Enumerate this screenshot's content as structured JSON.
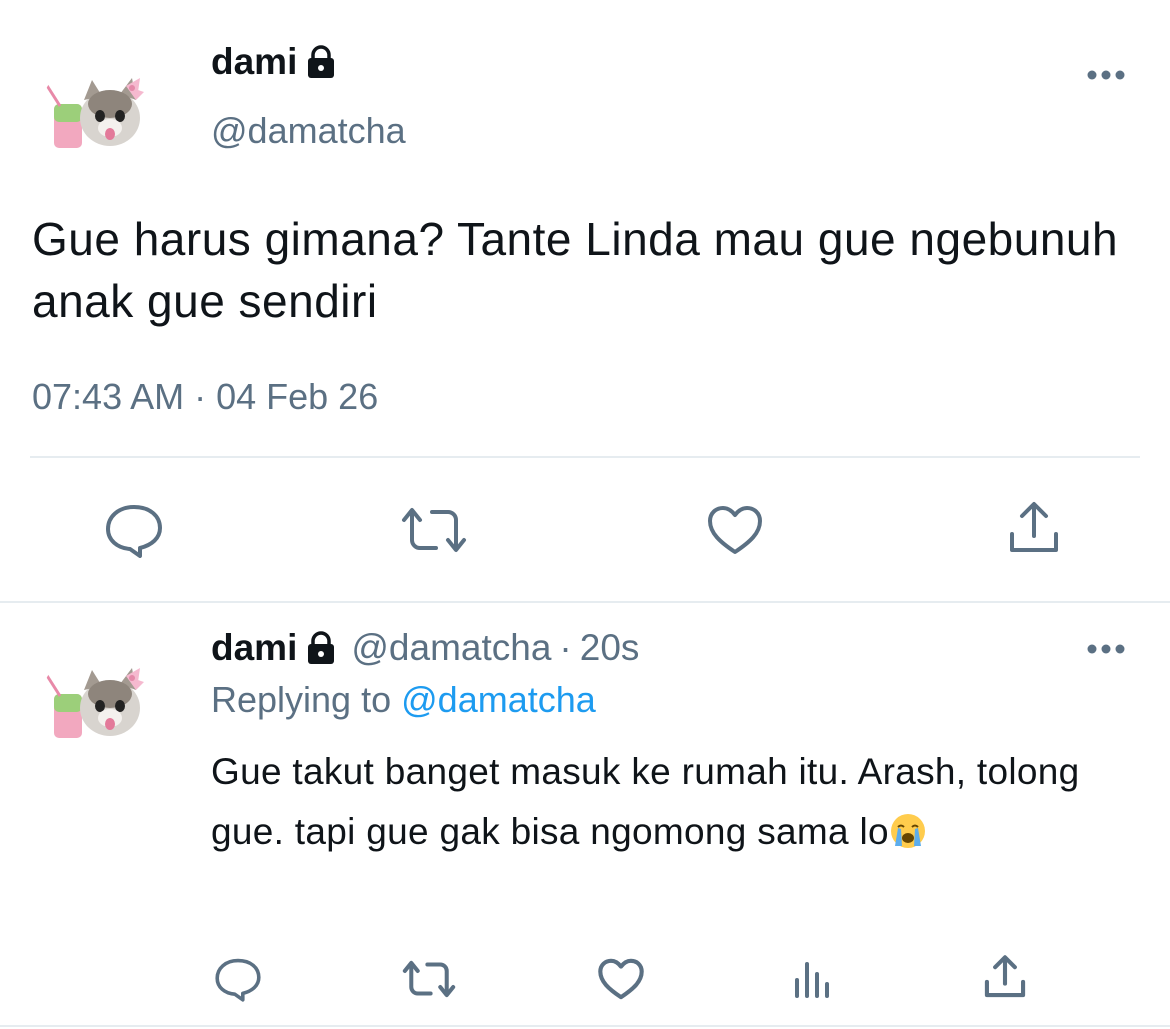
{
  "main_tweet": {
    "author_name": "dami",
    "author_handle": "@damatcha",
    "text": "Gue harus gimana? Tante Linda mau gue ngebunuh anak gue sendiri",
    "timestamp": "07:43 AM · 04 Feb 26",
    "actions": [
      "reply-icon",
      "retweet-icon",
      "like-icon",
      "share-icon"
    ]
  },
  "reply": {
    "author_name": "dami",
    "author_handle": "@damatcha",
    "separator": "·",
    "time": "20s",
    "replying_prefix": "Replying to",
    "replying_to": "@damatcha",
    "text": "Gue takut banget masuk ke rumah itu. Arash, tolong gue. tapi gue gak bisa ngomong sama lo",
    "actions": [
      "reply-icon",
      "retweet-icon",
      "like-icon",
      "analytics-icon",
      "share-icon"
    ]
  },
  "colors": {
    "text": "#0f1419",
    "secondary": "#5b7083",
    "link": "#1d9bf0",
    "divider": "#e6ecf0"
  }
}
